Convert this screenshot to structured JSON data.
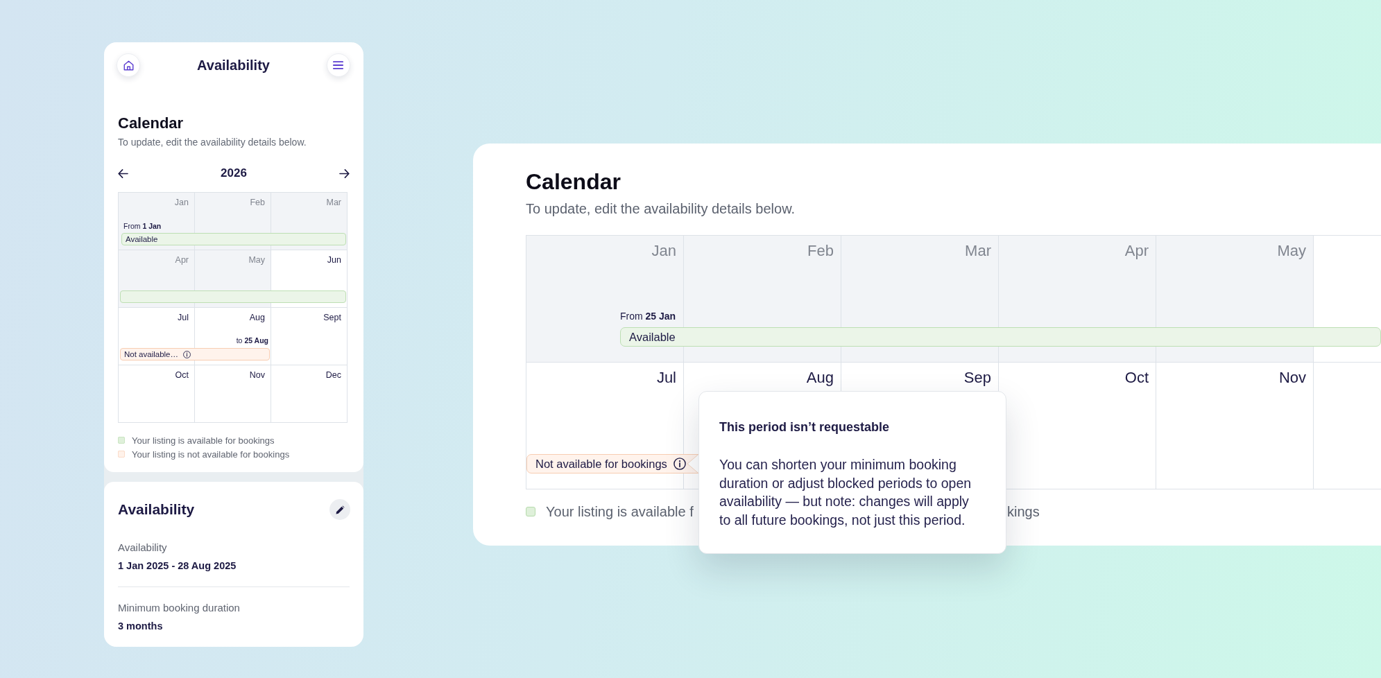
{
  "mobile": {
    "title": "Availability",
    "calendar": {
      "title": "Calendar",
      "subtitle": "To update, edit the availability details below.",
      "year": "2026",
      "rows": [
        {
          "months": [
            {
              "label": "Jan",
              "past": true,
              "caption": "From **1 Jan**"
            },
            {
              "label": "Feb",
              "past": true
            },
            {
              "label": "Mar",
              "past": true
            }
          ],
          "band": {
            "kind": "from",
            "available": true,
            "label": "Available",
            "info": false
          }
        },
        {
          "months": [
            {
              "label": "Apr",
              "past": true
            },
            {
              "label": "May",
              "past": true
            },
            {
              "label": "Jun",
              "past": false
            }
          ],
          "band": {
            "kind": "full",
            "available": true,
            "info": false
          }
        },
        {
          "months": [
            {
              "label": "Jul",
              "past": false
            },
            {
              "label": "Aug",
              "past": false,
              "caption": "to **25 Aug**"
            },
            {
              "label": "Sept",
              "past": false
            }
          ],
          "band": {
            "kind": "until",
            "available": false,
            "label": "Not available…",
            "info": true
          }
        },
        {
          "months": [
            {
              "label": "Oct",
              "past": false
            },
            {
              "label": "Nov",
              "past": false
            },
            {
              "label": "Dec",
              "past": false
            }
          ]
        }
      ],
      "legend": [
        {
          "kind": "available",
          "text": "Your listing is available for bookings"
        },
        {
          "kind": "unavailable",
          "text": "Your listing is not available for bookings"
        }
      ]
    },
    "details": {
      "title": "Availability",
      "fields": [
        {
          "label": "Availability",
          "value": "1 Jan 2025 - 28 Aug 2025"
        },
        {
          "label": "Minimum booking duration",
          "value": "3 months"
        }
      ]
    }
  },
  "desktop": {
    "calendar": {
      "title": "Calendar",
      "subtitle": "To update, edit the availability details below.",
      "rows": [
        {
          "months": [
            {
              "label": "Jan",
              "past": true,
              "caption": "From **25 Jan**"
            },
            {
              "label": "Feb",
              "past": true
            },
            {
              "label": "Mar",
              "past": true
            },
            {
              "label": "Apr",
              "past": true
            },
            {
              "label": "May",
              "past": true
            },
            {
              "past": false
            }
          ],
          "band": {
            "kind": "from",
            "available": true,
            "label": "Available",
            "info": false
          }
        },
        {
          "months": [
            {
              "label": "Jul",
              "past": false
            },
            {
              "label": "Aug",
              "past": false
            },
            {
              "label": "Sep",
              "past": false
            },
            {
              "label": "Oct",
              "past": false
            },
            {
              "label": "Nov",
              "past": false
            },
            {
              "past": false
            }
          ],
          "band": {
            "kind": "chip",
            "available": false,
            "label": "Not available for bookings",
            "info": true
          }
        }
      ],
      "legend": [
        {
          "kind": "available",
          "text": "Your listing is available f"
        },
        {
          "kind": "fragment",
          "text": "kings"
        }
      ]
    },
    "tooltip": {
      "title": "This period isn’t requestable",
      "text": "You can shorten your minimum booking duration or adjust blocked periods to open availability — but note: changes will apply to all future bookings, not just this period."
    }
  }
}
